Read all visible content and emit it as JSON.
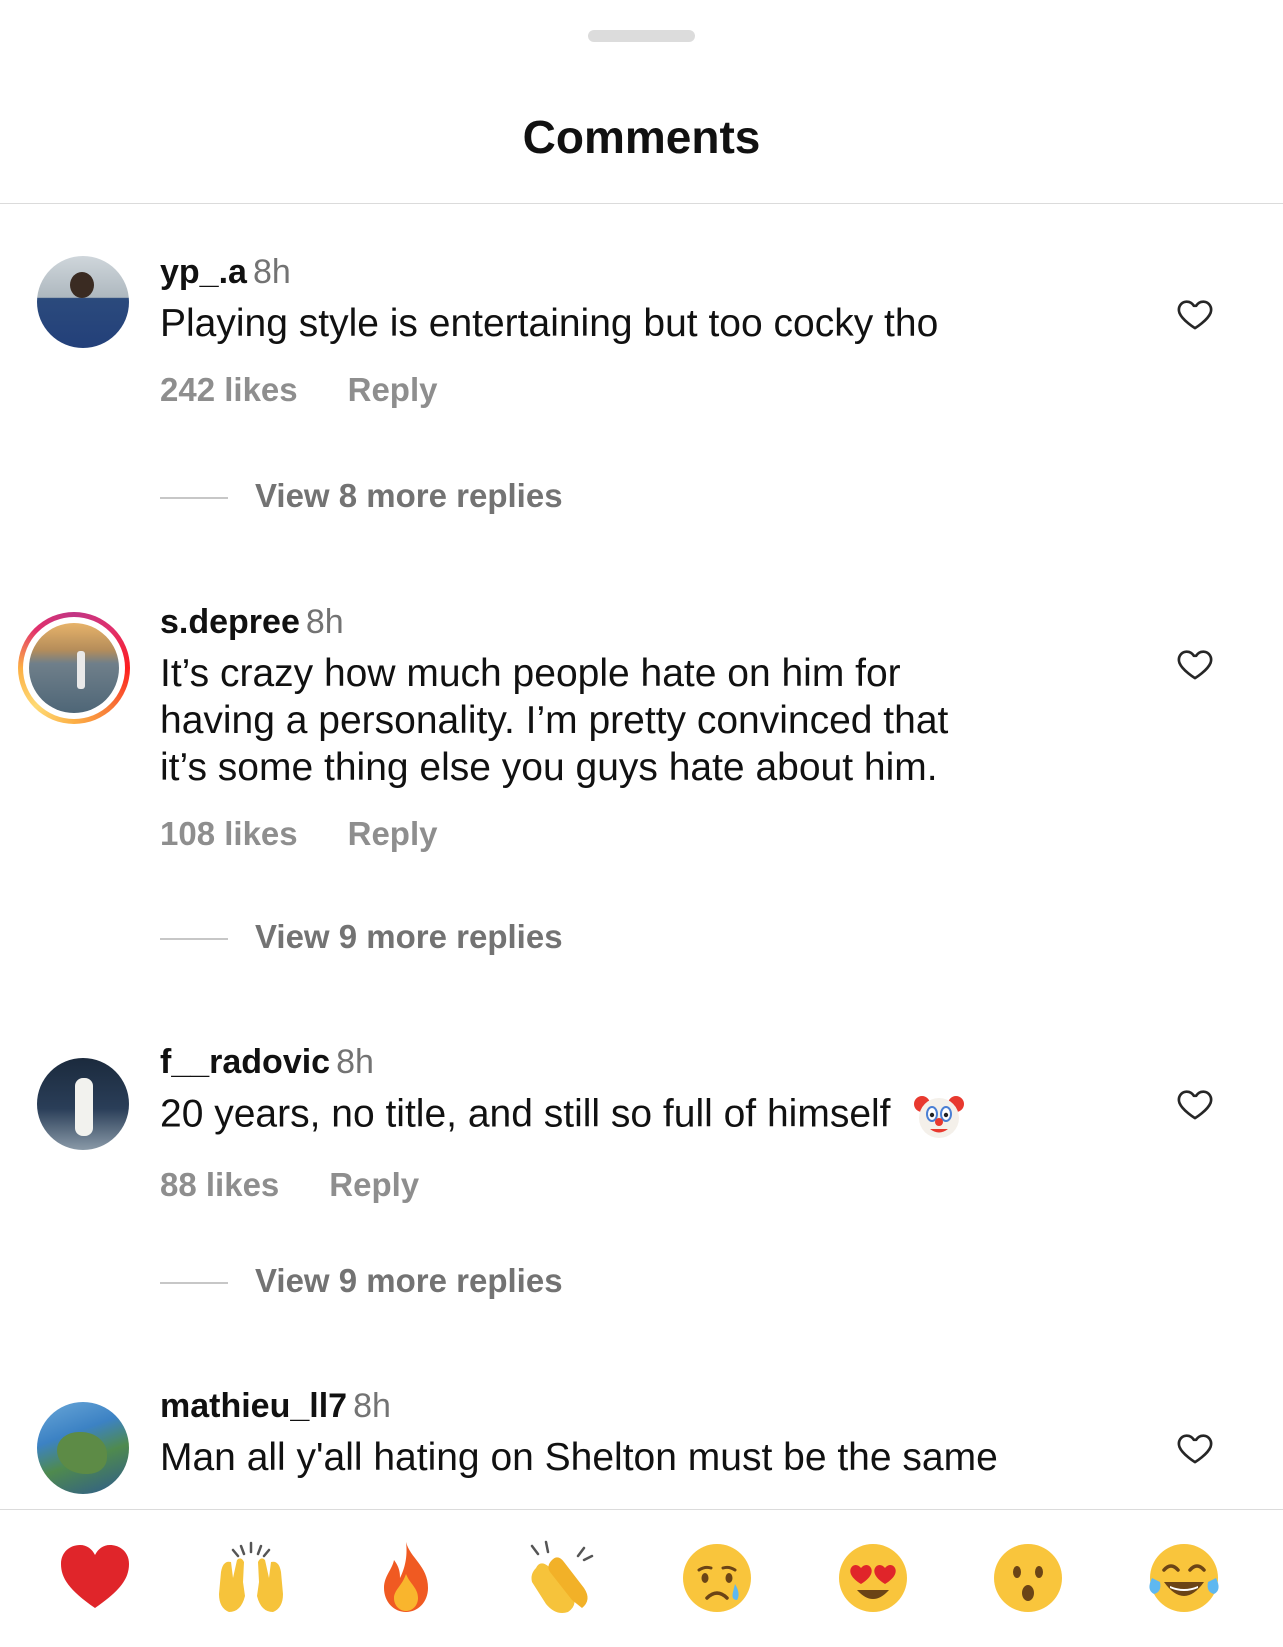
{
  "header": {
    "title": "Comments"
  },
  "comments": [
    {
      "username": "yp_.a",
      "time": "8h",
      "text": "Playing style is entertaining but too cocky tho",
      "likes": "242 likes",
      "reply": "Reply",
      "view_replies": "View 8 more replies",
      "avatar_icon": "user-photo-icon"
    },
    {
      "username": "s.depree",
      "time": "8h",
      "text_lines": [
        "It’s crazy how much people hate on him for",
        "having a personality. I’m pretty convinced that",
        "it’s some thing else you guys hate about him."
      ],
      "likes": "108 likes",
      "reply": "Reply",
      "view_replies": "View 9 more replies",
      "avatar_icon": "user-photo-icon",
      "story_ring": true
    },
    {
      "username": "f__radovic",
      "time": "8h",
      "text": "20 years, no title, and still so full of himself",
      "emoji": "clown-face",
      "likes": "88 likes",
      "reply": "Reply",
      "view_replies": "View 9 more replies",
      "avatar_icon": "user-photo-icon"
    },
    {
      "username": "mathieu_ll7",
      "time": "8h",
      "text": "Man all y'all hating on Shelton must be the same",
      "avatar_icon": "user-photo-icon"
    }
  ],
  "reactions": [
    "red-heart",
    "raising-hands",
    "fire",
    "clapping-hands",
    "crying-face",
    "heart-eyes-face",
    "surprised-face",
    "tears-of-joy-face"
  ],
  "colors": {
    "text": "#111111",
    "muted": "#737373",
    "actions": "#8e8e8e",
    "divider": "#dbdbdb"
  }
}
